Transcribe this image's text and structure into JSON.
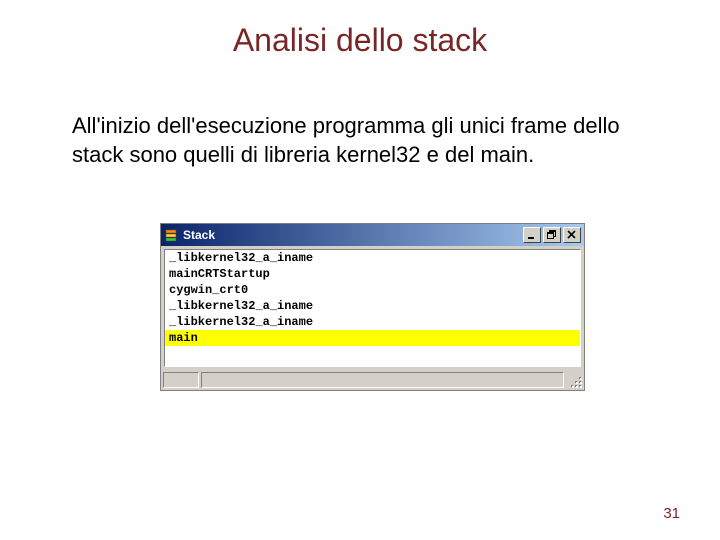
{
  "title": "Analisi dello stack",
  "body": "All'inizio dell'esecuzione programma gli unici frame dello stack sono quelli di libreria kernel32 e del main.",
  "window": {
    "title": "Stack",
    "icon_name": "stack-app-icon",
    "buttons": {
      "minimize": "minimize-button",
      "restore": "restore-button",
      "close": "close-button"
    },
    "stack_frames": [
      {
        "label": "_libkernel32_a_iname",
        "selected": false
      },
      {
        "label": "mainCRTStartup",
        "selected": false
      },
      {
        "label": "cygwin_crt0",
        "selected": false
      },
      {
        "label": "_libkernel32_a_iname",
        "selected": false
      },
      {
        "label": "_libkernel32_a_iname",
        "selected": false
      },
      {
        "label": "main",
        "selected": true
      }
    ]
  },
  "page_number": "31"
}
